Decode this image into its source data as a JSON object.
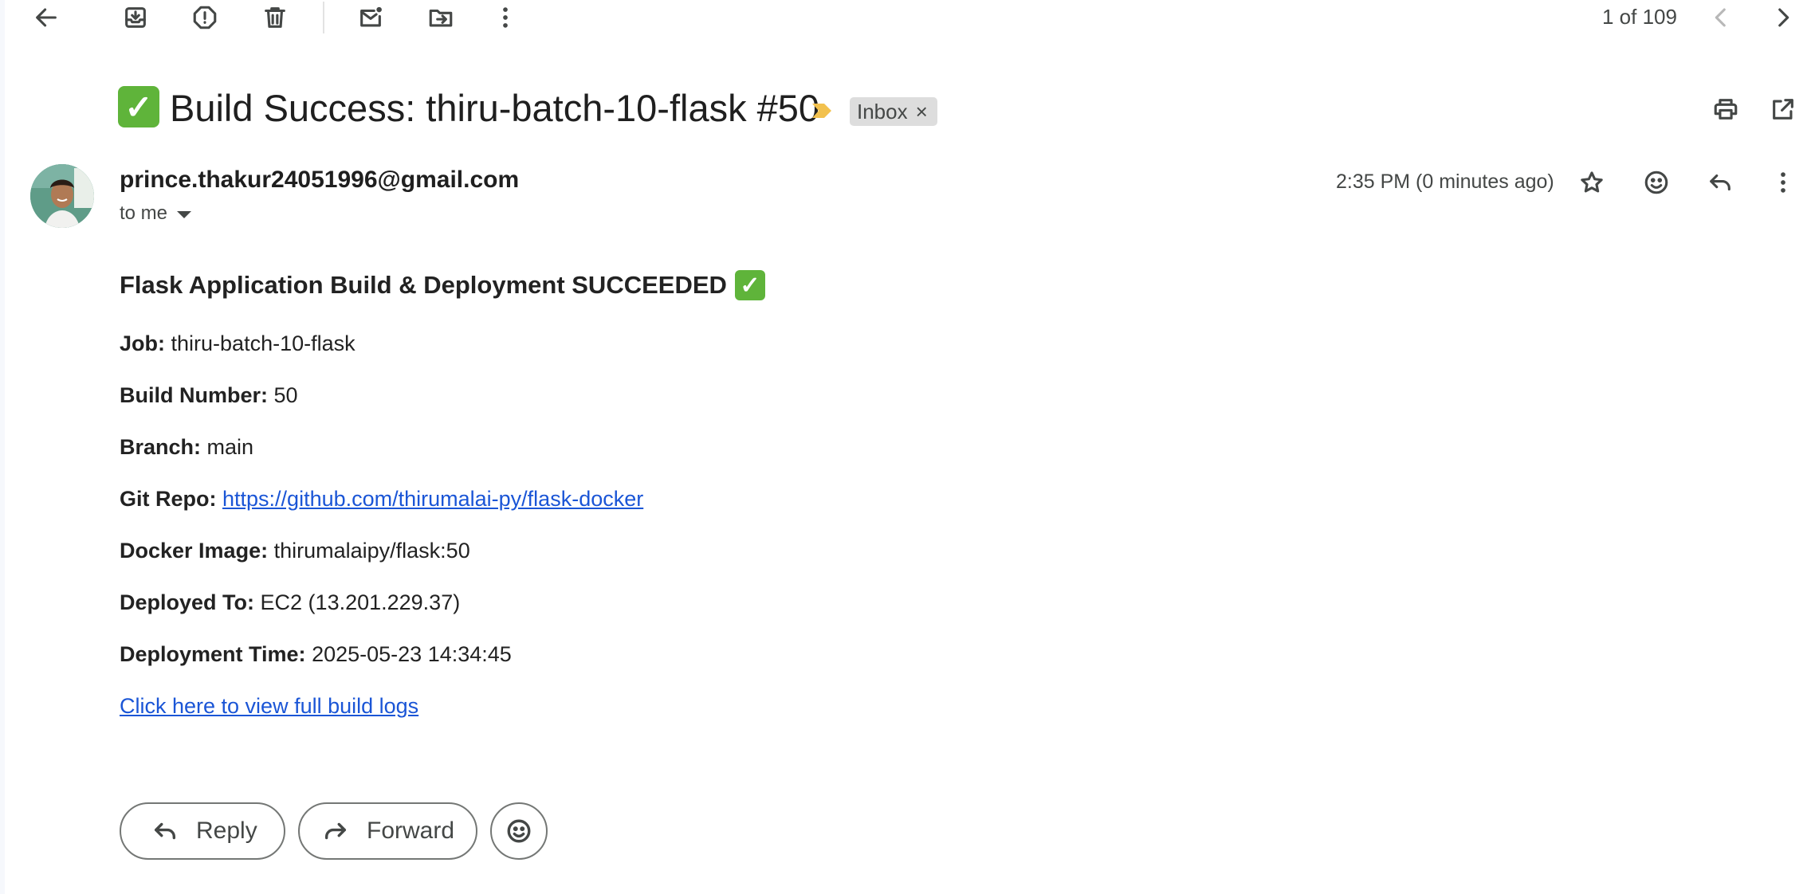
{
  "toolbar": {
    "back": "back-arrow-icon",
    "archive": "archive-icon",
    "spam": "report-spam-icon",
    "delete": "trash-icon",
    "mark_unread": "mark-unread-icon",
    "move_to": "move-to-icon",
    "more": "more-vert-icon",
    "counter": "1 of 109"
  },
  "email": {
    "subject": "Build Success: thiru-batch-10-flask #50",
    "subject_emoji": "✓",
    "label": "Inbox",
    "label_remove": "×",
    "sender": "prince.thakur24051996@gmail.com",
    "recipient": "to me",
    "time": "2:35 PM (0 minutes ago)"
  },
  "body": {
    "heading": "Flask Application Build & Deployment SUCCEEDED",
    "heading_emoji": "✓",
    "fields": [
      {
        "label": "Job:",
        "value": "thiru-batch-10-flask"
      },
      {
        "label": "Build Number:",
        "value": "50"
      },
      {
        "label": "Branch:",
        "value": "main"
      },
      {
        "label": "Git Repo:",
        "value": "https://github.com/thirumalai-py/flask-docker"
      },
      {
        "label": "Docker Image:",
        "value": "thirumalaipy/flask:50"
      },
      {
        "label": "Deployed To:",
        "value": "EC2 (13.201.229.37)"
      },
      {
        "label": "Deployment Time:",
        "value": "2025-05-23 14:34:45"
      }
    ],
    "logs_link": "Click here to view full build logs"
  },
  "actions": {
    "reply": "Reply",
    "forward": "Forward"
  },
  "colors": {
    "accent_link": "#1a55d6",
    "important_marker": "#f2c14e",
    "emoji_green": "#5fb43a",
    "label_bg": "#dddddd"
  }
}
